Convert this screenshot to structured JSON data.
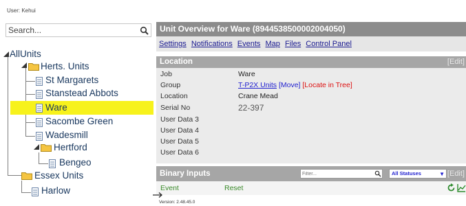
{
  "header": {
    "user_label": "User: Kehui"
  },
  "search": {
    "placeholder": "Search..."
  },
  "tree": {
    "root": "AllUnits",
    "groups": [
      {
        "label": "Herts. Units",
        "children": [
          "St Margarets",
          "Stanstead Abbots",
          "Ware",
          "Sacombe Green",
          "Wadesmill"
        ]
      },
      {
        "label": "Hertford",
        "children": [
          "Bengeo"
        ]
      },
      {
        "label": "Essex Units",
        "children": [
          "Harlow"
        ]
      }
    ],
    "selected": "Ware"
  },
  "unit_overview": {
    "title": "Unit Overview for Ware (89445385000020040​50)",
    "title_text": "Unit Overview for Ware (89445385000020040​50)",
    "tabs": [
      "Settings",
      "Notifications",
      "Events",
      "Map",
      "Files",
      "Control Panel"
    ]
  },
  "location": {
    "header": "Location",
    "edit_label": "[Edit]",
    "fields": [
      {
        "label": "Job",
        "value": "Ware"
      },
      {
        "label": "Group",
        "value": "T-P2X Units"
      },
      {
        "label": "Location",
        "value": "Crane Mead"
      },
      {
        "label": "Serial No",
        "value": "22-397"
      },
      {
        "label": "User Data 3",
        "value": ""
      },
      {
        "label": "User Data 4",
        "value": ""
      },
      {
        "label": "User Data 5",
        "value": ""
      },
      {
        "label": "User Data 6",
        "value": ""
      }
    ],
    "group_move": "[Move]",
    "group_locate": "[Locate in Tree]"
  },
  "binary_inputs": {
    "header": "Binary Inputs",
    "filter_placeholder": "Filter...",
    "status_selected": "All Statuses",
    "edit_label": "[Edit]",
    "row": {
      "col1": "Event",
      "col2": "Reset"
    }
  },
  "footer": {
    "version": "Version: 2.48.45.0"
  },
  "colors": {
    "title_bar": "#8c8c8c",
    "section_head": "#a6a6a6",
    "selected": "#f7f21c",
    "link": "#1e1ecf",
    "link_alert": "#dd1111"
  }
}
